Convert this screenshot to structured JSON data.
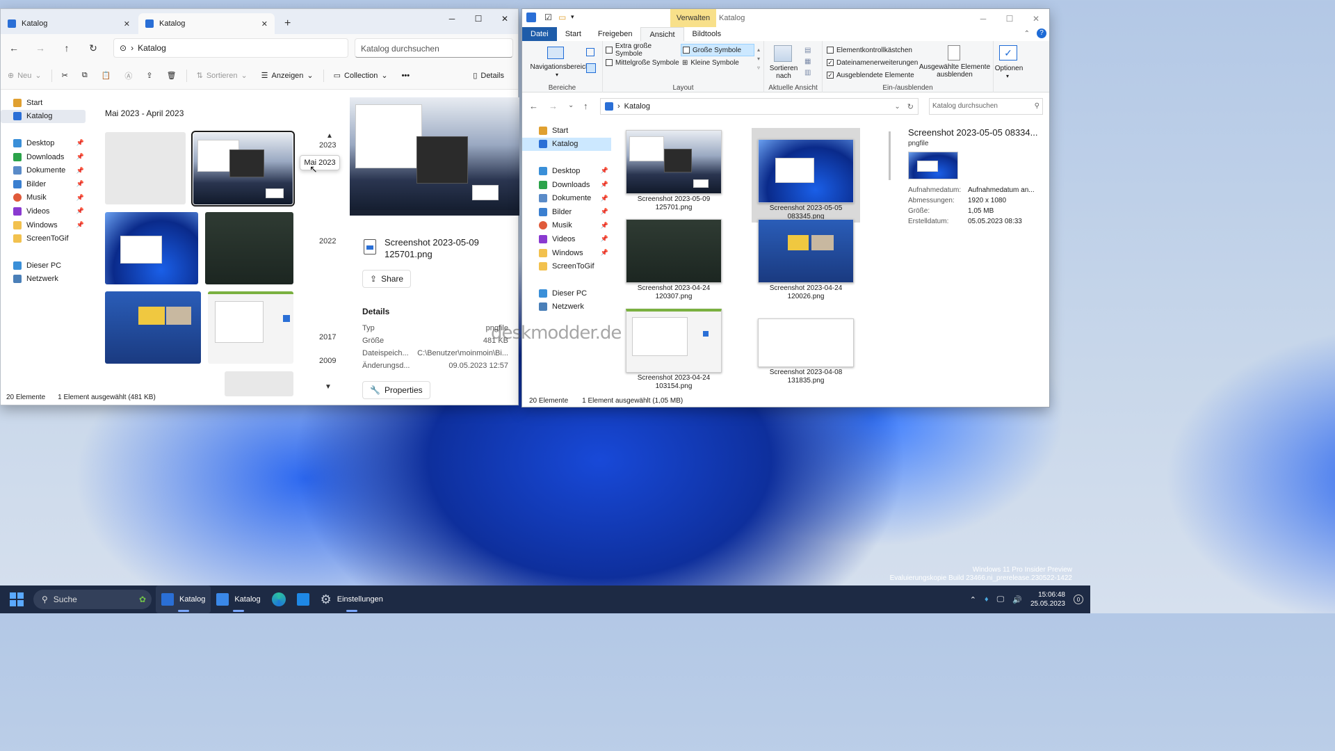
{
  "w1": {
    "tabs": [
      "Katalog",
      "Katalog"
    ],
    "address": "Katalog",
    "search_placeholder": "Katalog durchsuchen",
    "cmd": {
      "new": "Neu",
      "sort": "Sortieren",
      "view": "Anzeigen",
      "collection": "Collection",
      "more": "•••",
      "details": "Details"
    },
    "nav": [
      {
        "label": "Start",
        "icon": "home-icon"
      },
      {
        "label": "Katalog",
        "icon": "gallery-icon",
        "selected": true
      },
      {
        "label": "Desktop",
        "icon": "desktop-icon",
        "pinned": true
      },
      {
        "label": "Downloads",
        "icon": "download-icon",
        "pinned": true
      },
      {
        "label": "Dokumente",
        "icon": "documents-icon",
        "pinned": true
      },
      {
        "label": "Bilder",
        "icon": "pictures-icon",
        "pinned": true
      },
      {
        "label": "Musik",
        "icon": "music-icon",
        "pinned": true
      },
      {
        "label": "Videos",
        "icon": "videos-icon",
        "pinned": true
      },
      {
        "label": "Windows",
        "icon": "folder-icon",
        "pinned": true
      },
      {
        "label": "ScreenToGif",
        "icon": "folder-icon"
      },
      {
        "label": "Dieser PC",
        "icon": "pc-icon"
      },
      {
        "label": "Netzwerk",
        "icon": "network-icon"
      }
    ],
    "gallery_heading": "Mai 2023 - April 2023",
    "timeline": [
      "2023",
      "2022",
      "2017",
      "2009"
    ],
    "tooltip": "Mai 2023",
    "details": {
      "filename": "Screenshot 2023-05-09 125701.png",
      "share": "Share",
      "heading": "Details",
      "rows": [
        {
          "k": "Typ",
          "v": "pngfile"
        },
        {
          "k": "Größe",
          "v": "481 KB"
        },
        {
          "k": "Dateispeich...",
          "v": "C:\\Benutzer\\moinmoin\\Bi..."
        },
        {
          "k": "Änderungsd...",
          "v": "09.05.2023 12:57"
        }
      ],
      "properties": "Properties"
    },
    "status": {
      "count": "20 Elemente",
      "selection": "1 Element ausgewählt (481 KB)"
    }
  },
  "w2": {
    "context_tab": "Verwalten",
    "title": "Katalog",
    "ribbon_tabs": [
      "Datei",
      "Start",
      "Freigeben",
      "Ansicht",
      "Bildtools"
    ],
    "ribbon": {
      "nav_pane": "Navigationsbereich",
      "bereiche": "Bereiche",
      "layout_items": [
        "Extra große Symbole",
        "Große Symbole",
        "Mittelgroße Symbole",
        "Kleine Symbole"
      ],
      "layout": "Layout",
      "sort": "Sortieren nach",
      "current_view": "Aktuelle Ansicht",
      "checks": [
        {
          "label": "Elementkontrollkästchen",
          "checked": false
        },
        {
          "label": "Dateinamenerweiterungen",
          "checked": true
        },
        {
          "label": "Ausgeblendete Elemente",
          "checked": true
        }
      ],
      "hide_selected": "Ausgewählte Elemente ausblenden",
      "show_hide": "Ein-/ausblenden",
      "options": "Optionen"
    },
    "address": "Katalog",
    "search_placeholder": "Katalog durchsuchen",
    "nav": [
      {
        "label": "Start"
      },
      {
        "label": "Katalog"
      },
      {
        "label": "Desktop"
      },
      {
        "label": "Downloads"
      },
      {
        "label": "Dokumente"
      },
      {
        "label": "Bilder"
      },
      {
        "label": "Musik"
      },
      {
        "label": "Videos"
      },
      {
        "label": "Windows"
      },
      {
        "label": "ScreenToGif"
      },
      {
        "label": "Dieser PC"
      },
      {
        "label": "Netzwerk"
      }
    ],
    "files": [
      {
        "name": "Screenshot 2023-05-09 125701.png",
        "l1": "Screenshot 2023-05-09",
        "l2": "125701.png"
      },
      {
        "name": "Screenshot 2023-05-05 083345.png",
        "l1": "Screenshot 2023-05-05",
        "l2": "083345.png"
      },
      {
        "name": "Screenshot 2023-04-24 120307.png",
        "l1": "Screenshot 2023-04-24",
        "l2": "120307.png"
      },
      {
        "name": "Screenshot 2023-04-24 120026.png",
        "l1": "Screenshot 2023-04-24",
        "l2": "120026.png"
      },
      {
        "name": "Screenshot 2023-04-24 103154.png",
        "l1": "Screenshot 2023-04-24",
        "l2": "103154.png"
      },
      {
        "name": "Screenshot 2023-04-08 131835.png",
        "l1": "Screenshot 2023-04-08",
        "l2": "131835.png"
      }
    ],
    "preview": {
      "title": "Screenshot 2023-05-05 08334...",
      "type": "pngfile",
      "rows": [
        {
          "k": "Aufnahmedatum:",
          "v": "Aufnahmedatum an..."
        },
        {
          "k": "Abmessungen:",
          "v": "1920 x 1080"
        },
        {
          "k": "Größe:",
          "v": "1,05 MB"
        },
        {
          "k": "Erstelldatum:",
          "v": "05.05.2023 08:33"
        }
      ]
    },
    "status": {
      "count": "20 Elemente",
      "selection": "1 Element ausgewählt (1,05 MB)"
    }
  },
  "brand": "deskmodder.de",
  "watermark": [
    "Windows 11 Pro Insider Preview",
    "Evaluierungskopie Build 23466.ni_prerelease.230522-1422"
  ],
  "taskbar": {
    "search": "Suche",
    "apps": [
      {
        "label": "Katalog",
        "icon": "gallery-icon"
      },
      {
        "label": "Katalog",
        "icon": "explorer-icon"
      },
      {
        "label": "",
        "icon": "edge-icon"
      },
      {
        "label": "",
        "icon": "store-icon"
      },
      {
        "label": "Einstellungen",
        "icon": "settings-icon"
      }
    ],
    "time": "15:06:48",
    "date": "25.05.2023",
    "notifications": "0"
  }
}
